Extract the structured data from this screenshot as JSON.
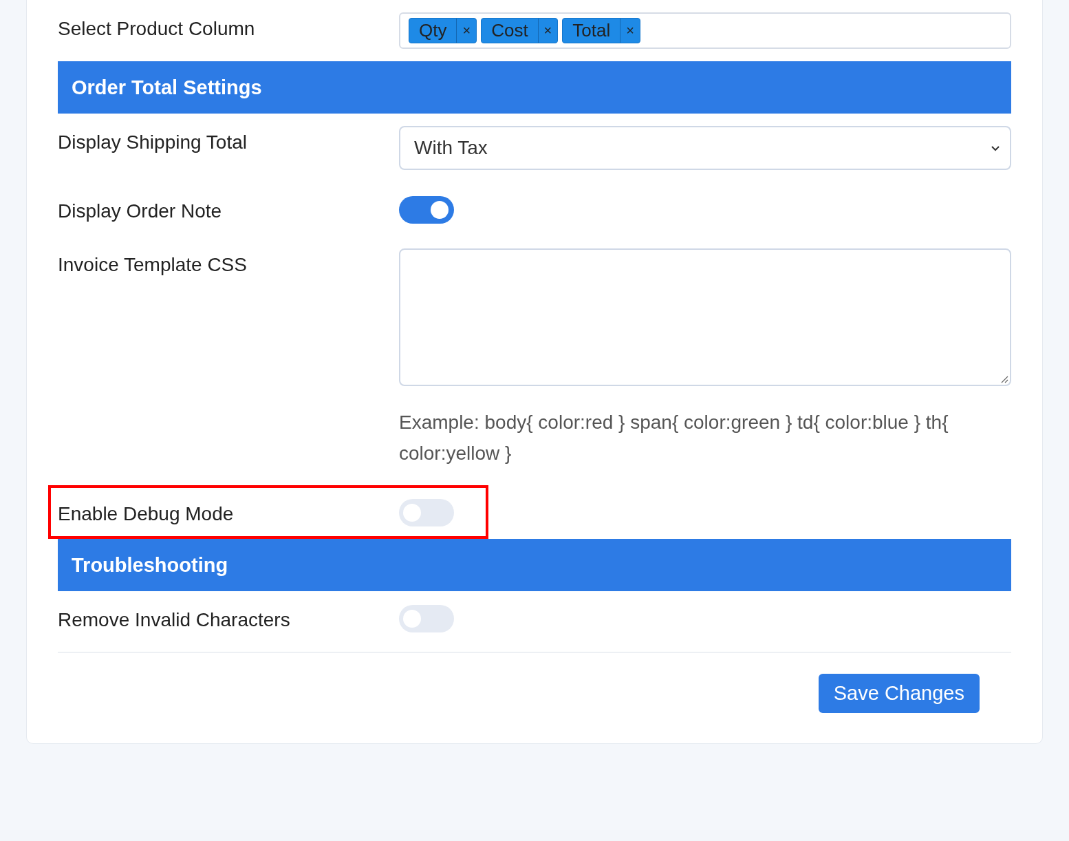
{
  "sections": [
    {
      "fields": [
        {
          "kind": "tags",
          "label": "Select Product Column",
          "tags": [
            "Qty",
            "Cost",
            "Total"
          ],
          "remove": "×",
          "highlighted": false
        }
      ]
    },
    {
      "title": "Order Total Settings",
      "fields": [
        {
          "kind": "select",
          "label": "Display Shipping Total",
          "value": "With Tax",
          "highlighted": false
        },
        {
          "kind": "toggle",
          "label": "Display Order Note",
          "on": true,
          "highlighted": false
        },
        {
          "kind": "textarea",
          "label": "Invoice Template CSS",
          "help": "Example: body{ color:red } span{ color:green } td{ color:blue } th{ color:yellow }",
          "highlighted": false
        },
        {
          "kind": "toggle",
          "label": "Enable Debug Mode",
          "on": false,
          "highlighted": true
        }
      ]
    },
    {
      "title": "Troubleshooting",
      "fields": [
        {
          "kind": "toggle",
          "label": "Remove Invalid Characters",
          "on": false,
          "highlighted": false
        }
      ]
    }
  ],
  "save_button": "Save Changes"
}
